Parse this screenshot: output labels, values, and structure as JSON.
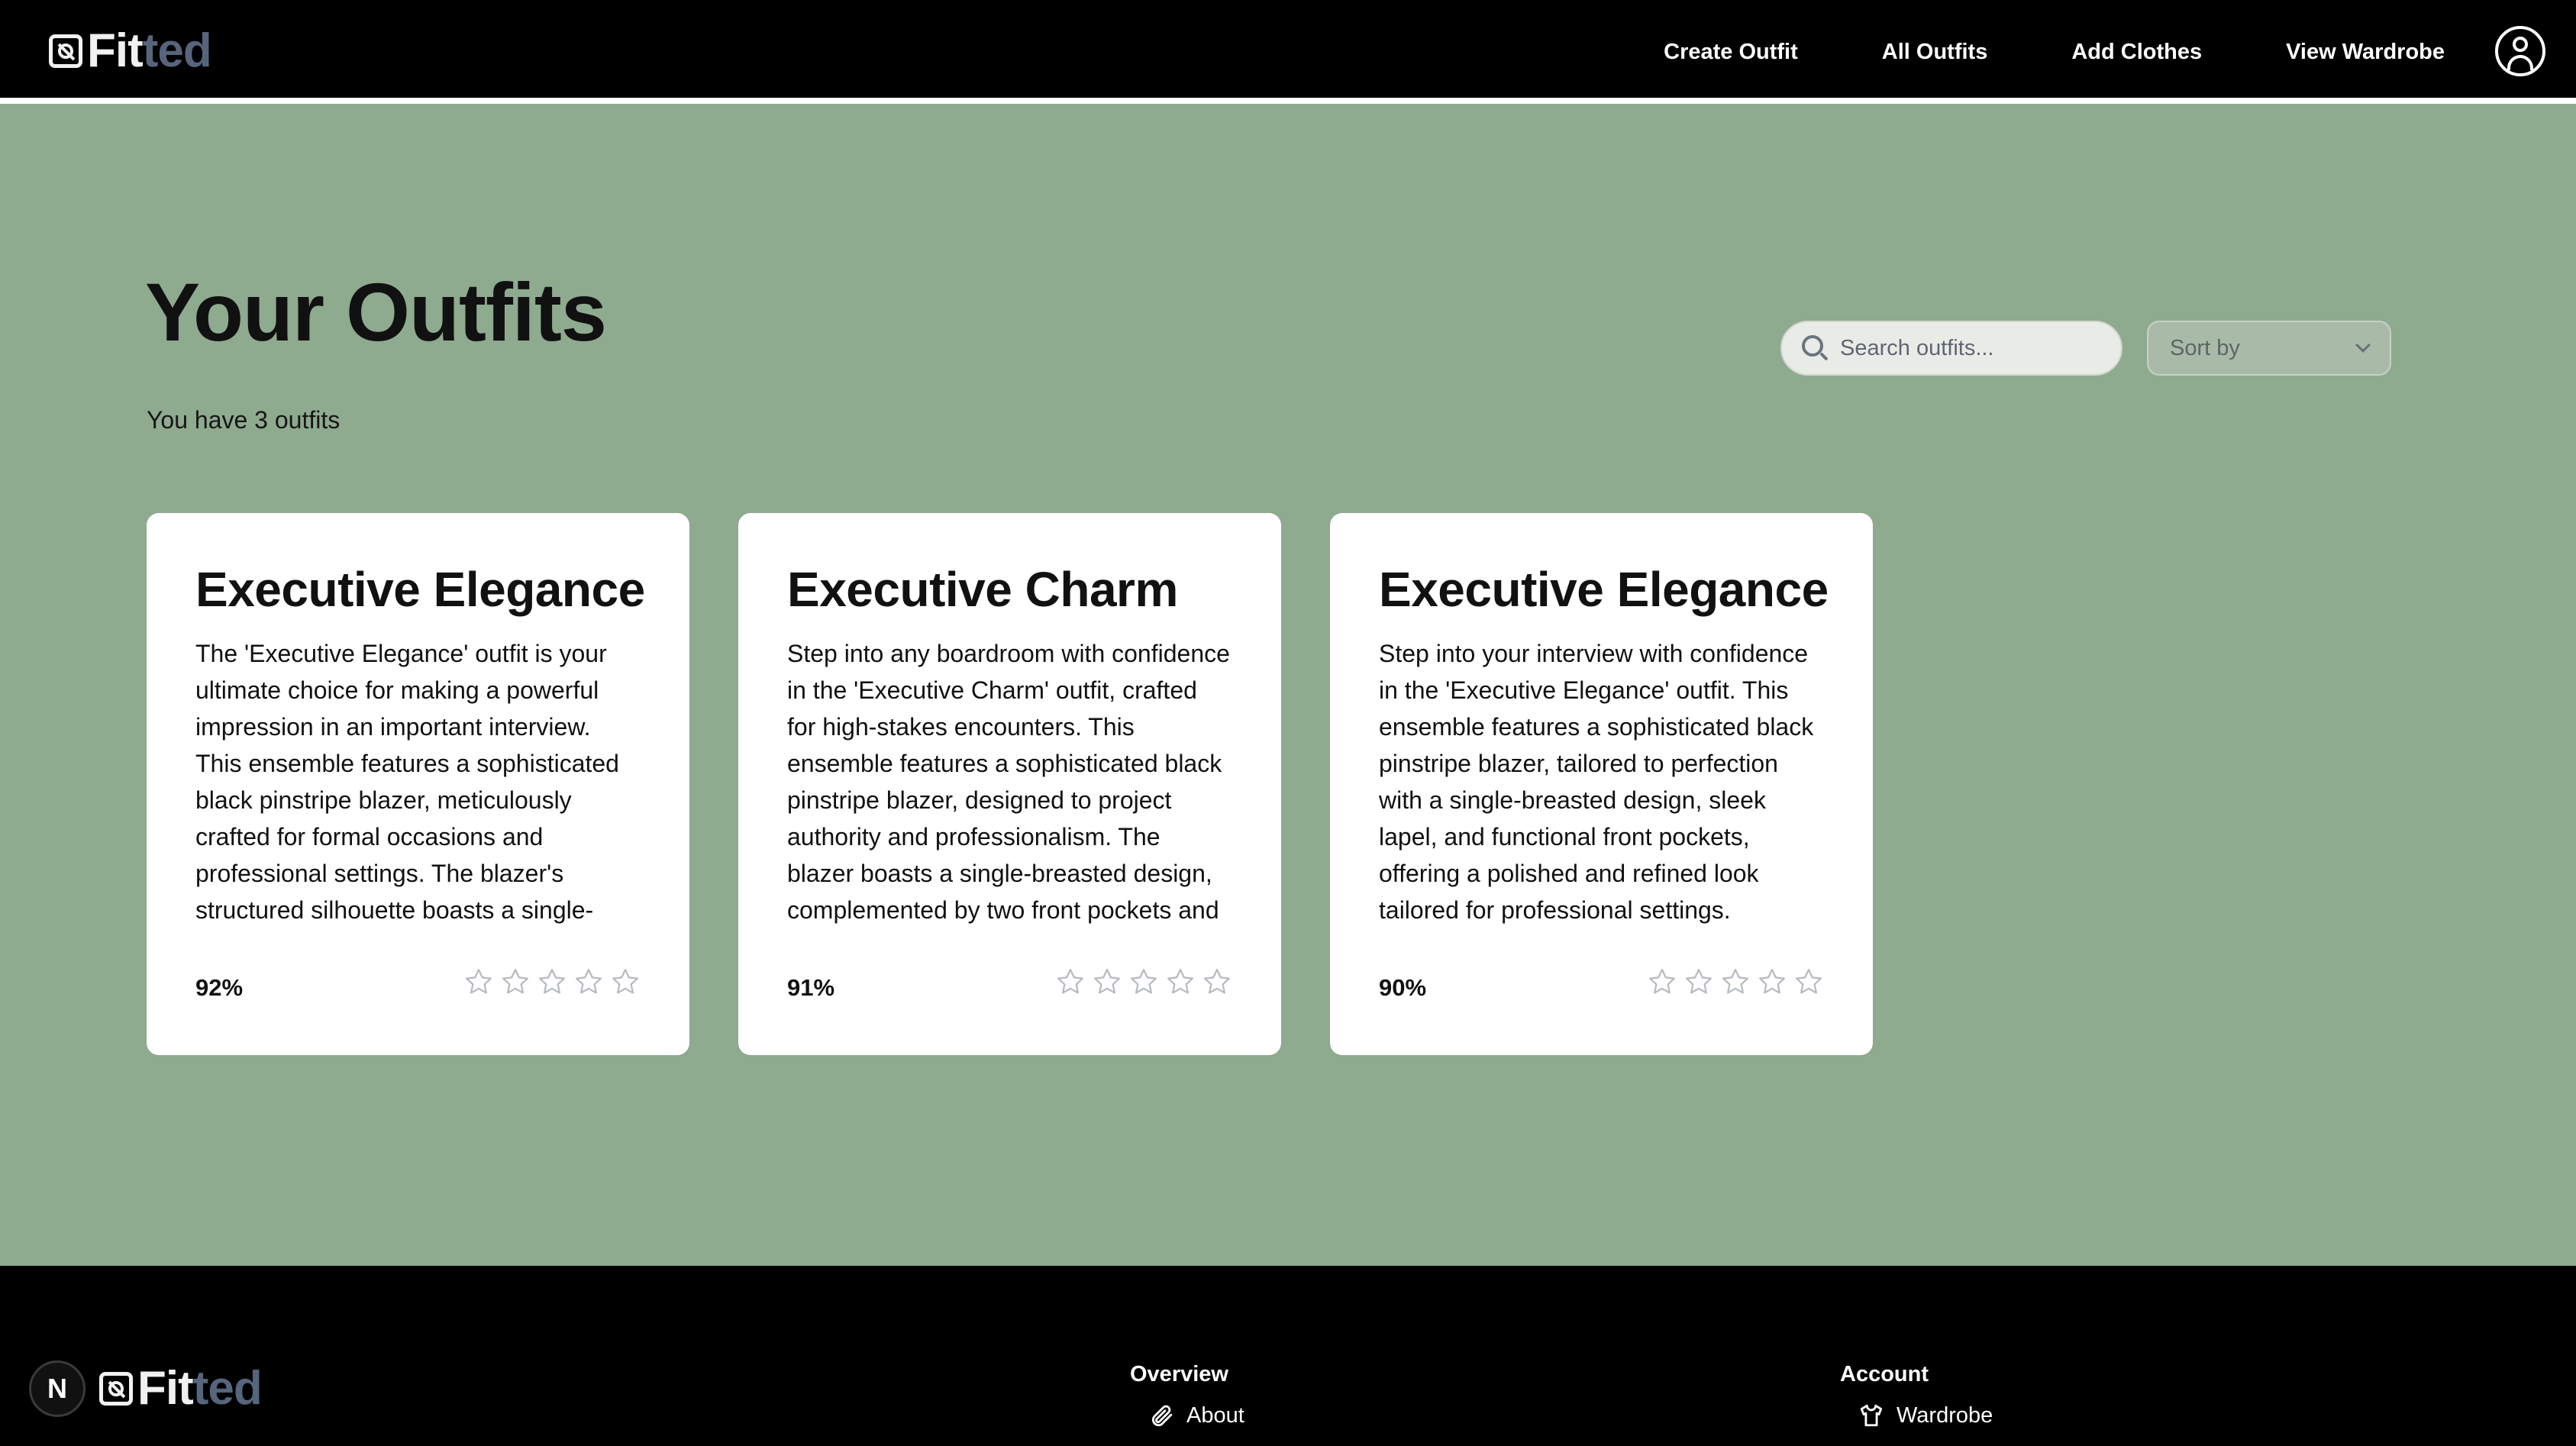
{
  "brand": {
    "fit": "Fit",
    "ted": "ted"
  },
  "nav": {
    "links": [
      "Create Outfit",
      "All Outfits",
      "Add Clothes",
      "View Wardrobe"
    ],
    "profile_icon": "user-circle-icon"
  },
  "main": {
    "title": "Your Outfits",
    "count_text": "You have 3 outfits",
    "search": {
      "placeholder": "Search outfits...",
      "icon": "search-icon"
    },
    "sort": {
      "label": "Sort by",
      "icon": "chevron-down-icon"
    }
  },
  "outfits": [
    {
      "title": "Executive Elegance",
      "description": "The 'Executive Elegance' outfit is your ultimate choice for making a powerful impression in an important interview. This ensemble features a sophisticated black pinstripe blazer, meticulously crafted for formal occasions and professional settings. The blazer's structured silhouette boasts a single-breasted design, complemented with two front",
      "match": "92%",
      "rating": 0
    },
    {
      "title": "Executive Charm",
      "description": "Step into any boardroom with confidence in the 'Executive Charm' outfit, crafted for high-stakes encounters. This ensemble features a sophisticated black pinstripe blazer, designed to project authority and professionalism. The blazer boasts a single-breasted design, complemented by two front pockets and a sleek lapel",
      "match": "91%",
      "rating": 0
    },
    {
      "title": "Executive Elegance",
      "description": "Step into your interview with confidence in the 'Executive Elegance' outfit. This ensemble features a sophisticated black pinstripe blazer, tailored to perfection with a single-breasted design, sleek lapel, and functional front pockets, offering a polished and refined look tailored for professional settings. Complementing",
      "match": "90%",
      "rating": 0
    }
  ],
  "footer": {
    "badge": "N",
    "overview": {
      "title": "Overview",
      "links": [
        {
          "label": "About",
          "icon": "paperclip-icon"
        }
      ]
    },
    "account": {
      "title": "Account",
      "links": [
        {
          "label": "Wardrobe",
          "icon": "shirt-icon"
        }
      ]
    }
  },
  "colors": {
    "page_bg": "#8eaa8f",
    "nav_bg": "#000000",
    "logo_ted": "#56657c",
    "card_bg": "#ffffff",
    "star_outline": "#b8bcc2"
  }
}
